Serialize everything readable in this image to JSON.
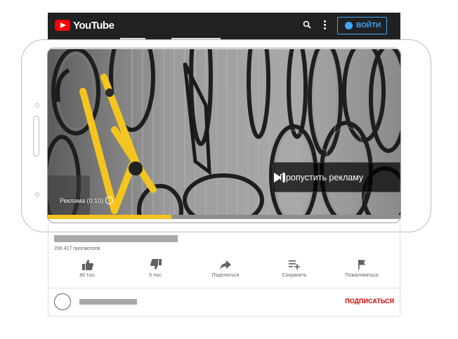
{
  "app": {
    "brand": "YouTube",
    "signin_label": "ВОЙТИ",
    "accent": "#3ea6ff",
    "logo_red": "#ff0000"
  },
  "ad": {
    "skip_label": "Пропустить рекламу",
    "ad_label": "Реклама (0:10)",
    "progress_fraction": 0.35,
    "progress_color": "#f6c220"
  },
  "video": {
    "views": "206 417 просмотров",
    "actions": [
      {
        "icon": "thumbs-up-icon",
        "label": "80 тыс."
      },
      {
        "icon": "thumbs-down-icon",
        "label": "5 тыс."
      },
      {
        "icon": "share-icon",
        "label": "Поделиться"
      },
      {
        "icon": "playlist-add-icon",
        "label": "Сохранить"
      },
      {
        "icon": "flag-icon",
        "label": "Пожаловаться"
      }
    ],
    "subscribe_label": "ПОДПИСАТЬСЯ",
    "subscribe_color": "#cc0000"
  }
}
